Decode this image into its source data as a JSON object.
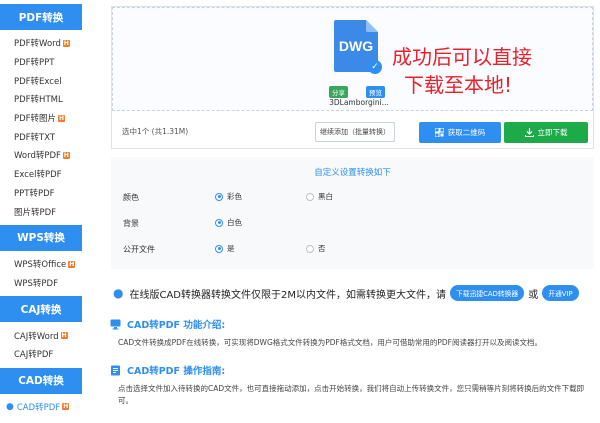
{
  "sidebar": {
    "sections": [
      {
        "title": "PDF转换",
        "items": [
          {
            "label": "PDF转Word",
            "hot": true
          },
          {
            "label": "PDF转PPT",
            "hot": false
          },
          {
            "label": "PDF转Excel",
            "hot": false
          },
          {
            "label": "PDF转HTML",
            "hot": false
          },
          {
            "label": "PDF转图片",
            "hot": true
          },
          {
            "label": "PDF转TXT",
            "hot": false
          },
          {
            "label": "Word转PDF",
            "hot": true
          },
          {
            "label": "Excel转PDF",
            "hot": false
          },
          {
            "label": "PPT转PDF",
            "hot": false
          },
          {
            "label": "图片转PDF",
            "hot": false
          }
        ]
      },
      {
        "title": "WPS转换",
        "items": [
          {
            "label": "WPS转Office",
            "hot": true
          },
          {
            "label": "WPS转PDF",
            "hot": false
          }
        ]
      },
      {
        "title": "CAJ转换",
        "items": [
          {
            "label": "CAJ转Word",
            "hot": true
          },
          {
            "label": "CAJ转PDF",
            "hot": false
          }
        ]
      },
      {
        "title": "CAD转换",
        "items": [
          {
            "label": "CAD转PDF",
            "hot": true,
            "active": true
          }
        ]
      }
    ],
    "hot_badge": "H"
  },
  "upload": {
    "file": {
      "ext": "DWG",
      "name": "3DLamborgini...",
      "share": "分享",
      "preview": "预览"
    },
    "overlay_line1": "成功后可以直接",
    "overlay_line2": "下载至本地!",
    "selection_info": "选中1个 (共1.31M)",
    "continue_btn": "继续添加（批量转换）",
    "qr_btn": "获取二维码",
    "download_btn": "立即下载"
  },
  "settings": {
    "title": "自定义设置转换如下",
    "rows": [
      {
        "label": "颜色",
        "options": [
          "彩色",
          "黑白"
        ],
        "selected": 0
      },
      {
        "label": "背景",
        "options": [
          "白色"
        ],
        "selected": 0
      },
      {
        "label": "公开文件",
        "options": [
          "是",
          "否"
        ],
        "selected": 0
      }
    ]
  },
  "notice": {
    "text": "在线版CAD转换器转换文件仅限于2M以内文件，如需转换更大文件，请",
    "btn_desktop": "下载迅捷CAD转换器",
    "or": "或",
    "btn_vip": "开通VIP"
  },
  "intro": {
    "title": "CAD转PDF 功能介绍:",
    "text": "CAD文件转换成PDF在线转换，可实现将DWG格式文件转换为PDF格式文档，用户可借助常用的PDF阅读器打开以及阅读文档。"
  },
  "guide": {
    "title": "CAD转PDF 操作指南:",
    "text": "点击选择文件加入待转换的CAD文件，也可直接拖动添加，点击开始转换，我们将自动上传转换文件，您只需稍等片刻将转换后的文件下载即可。"
  },
  "colors": {
    "accent": "#2f8ff0",
    "download_green": "#1dab4a",
    "hot_orange": "#f47b2a",
    "overlay_red": "#e8212b"
  }
}
